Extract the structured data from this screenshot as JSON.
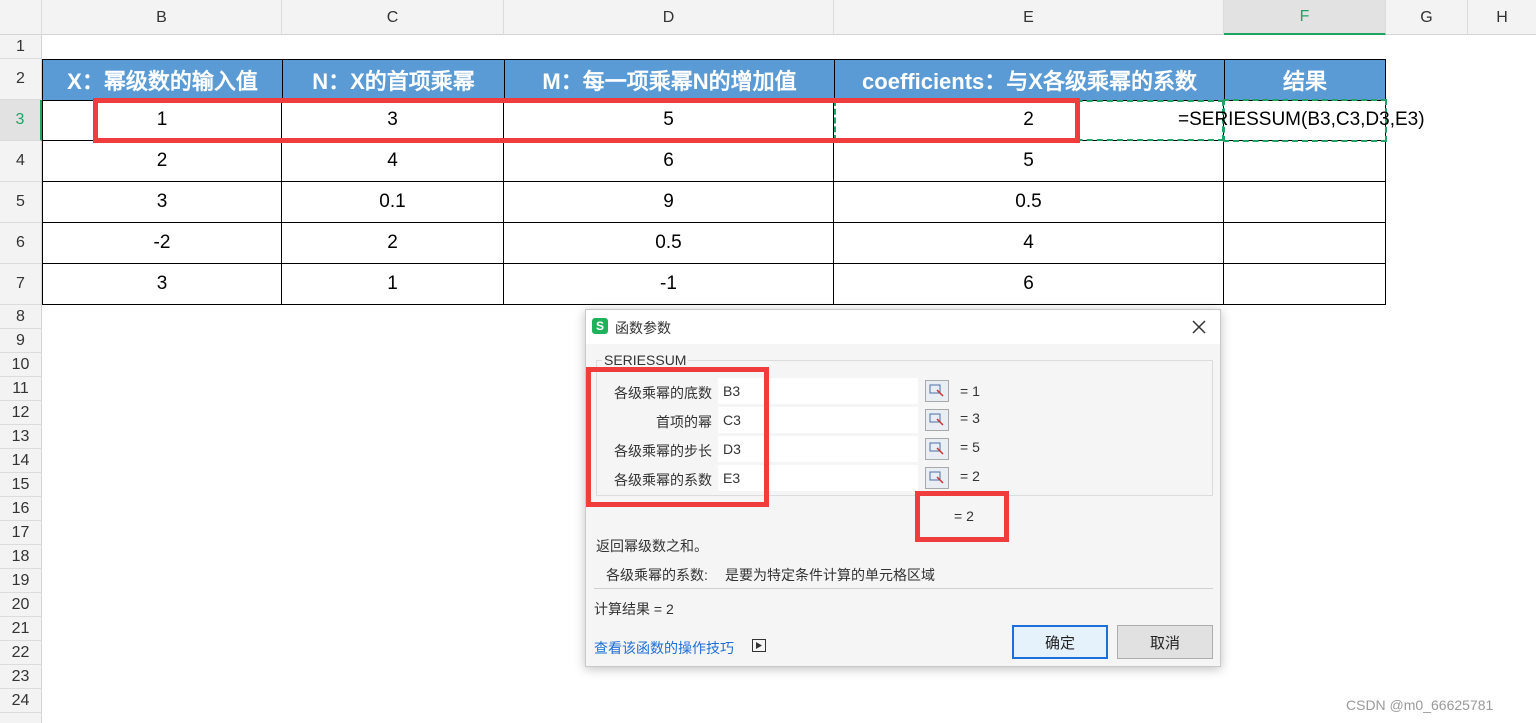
{
  "columns": [
    "B",
    "C",
    "D",
    "E",
    "F",
    "G",
    "H"
  ],
  "rows": [
    "1",
    "2",
    "3",
    "4",
    "5",
    "6",
    "7",
    "8",
    "9",
    "10",
    "11",
    "12",
    "13",
    "14",
    "15",
    "16",
    "17",
    "18",
    "19",
    "20",
    "21",
    "22",
    "23",
    "24"
  ],
  "table": {
    "headers": [
      "X：幂级数的输入值",
      "N：X的首项乘幂",
      "M：每一项乘幂N的增加值",
      "coefficients：与X各级乘幂的系数",
      "结果"
    ],
    "rows": [
      [
        "1",
        "3",
        "5",
        "2"
      ],
      [
        "2",
        "4",
        "6",
        "5"
      ],
      [
        "3",
        "0.1",
        "9",
        "0.5"
      ],
      [
        "-2",
        "2",
        "0.5",
        "4"
      ],
      [
        "3",
        "1",
        "-1",
        "6"
      ]
    ]
  },
  "formula": "=SERIESSUM(B3,C3,D3,E3)",
  "dialog": {
    "title": "函数参数",
    "function_name": "SERIESSUM",
    "args": [
      {
        "label": "各级乘幂的底数",
        "value": "B3",
        "result": "= 1"
      },
      {
        "label": "首项的幂",
        "value": "C3",
        "result": "= 3"
      },
      {
        "label": "各级乘幂的步长",
        "value": "D3",
        "result": "= 5"
      },
      {
        "label": "各级乘幂的系数",
        "value": "E3",
        "result": "= 2"
      }
    ],
    "result_display": "= 2",
    "description": "返回幂级数之和。",
    "param_help_label": "各级乘幂的系数:",
    "param_help_text": "是要为特定条件计算的单元格区域",
    "calc_result": "计算结果 = 2",
    "help_link": "查看该函数的操作技巧",
    "ok_label": "确定",
    "cancel_label": "取消"
  },
  "watermark": "CSDN @m0_66625781",
  "colors": {
    "header_blue": "#5b9bd5",
    "highlight_red": "#ef3d3d",
    "selection_green": "#21a366",
    "link_blue": "#1e6fd9"
  }
}
